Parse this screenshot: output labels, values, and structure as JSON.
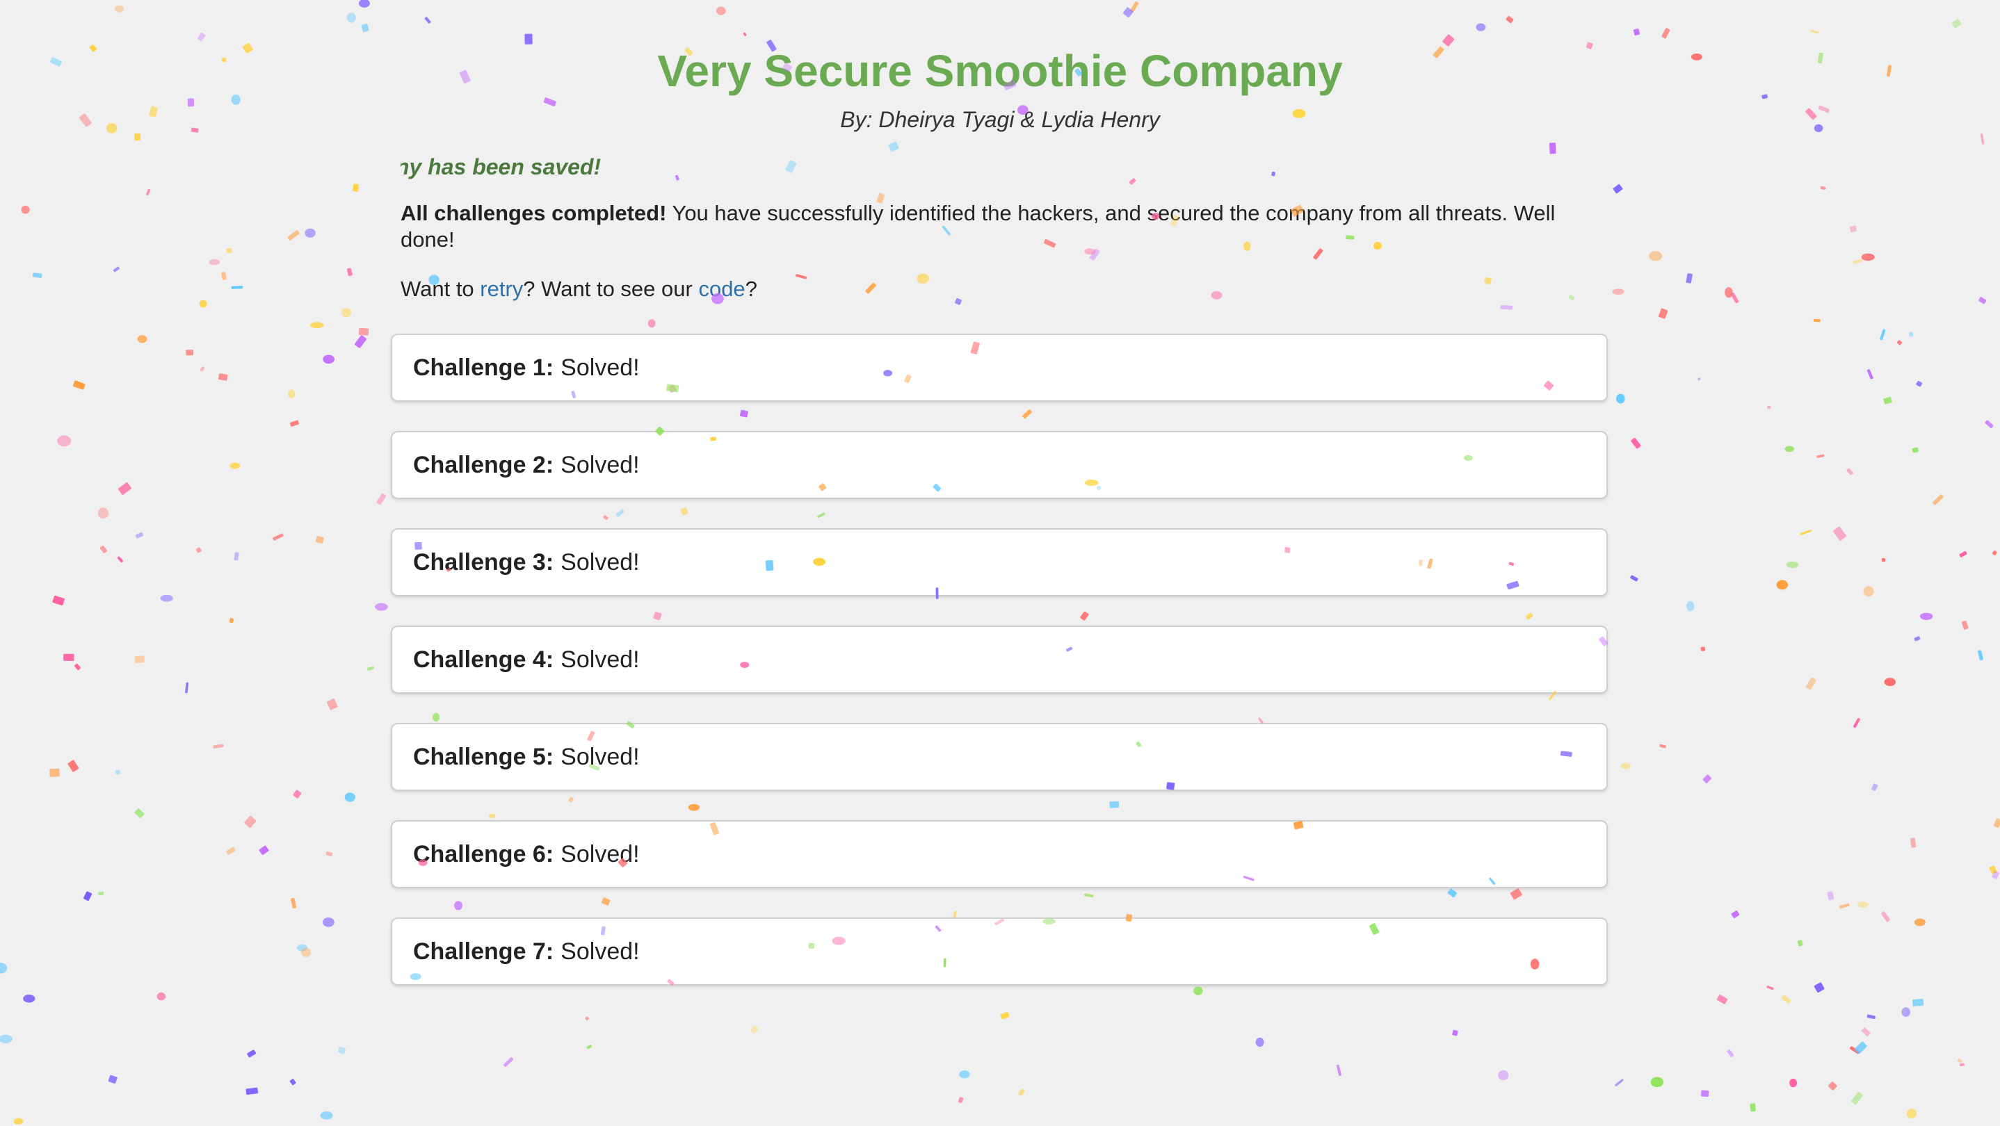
{
  "header": {
    "title": "Very Secure Smoothie Company",
    "byline": "By: Dheirya Tyagi & Lydia Henry"
  },
  "banner": {
    "scrolling_text": "The company has been saved!"
  },
  "message": {
    "bold": "All challenges completed!",
    "rest": " You have successfully identified the hackers, and secured the company from all threats. Well done!"
  },
  "links_line": {
    "prefix": "Want to ",
    "retry_label": "retry",
    "middle": "? Want to see our ",
    "code_label": "code",
    "suffix": "?"
  },
  "challenges": [
    {
      "name": "Challenge 1:",
      "status": "Solved!"
    },
    {
      "name": "Challenge 2:",
      "status": "Solved!"
    },
    {
      "name": "Challenge 3:",
      "status": "Solved!"
    },
    {
      "name": "Challenge 4:",
      "status": "Solved!"
    },
    {
      "name": "Challenge 5:",
      "status": "Solved!"
    },
    {
      "name": "Challenge 6:",
      "status": "Solved!"
    },
    {
      "name": "Challenge 7:",
      "status": "Solved!"
    }
  ],
  "colors": {
    "title": "#6aaa52",
    "banner": "#4b7a3e",
    "link": "#2f6fa8",
    "background": "#f0f0f0",
    "confetti": [
      "#ff5fa2",
      "#7b5cff",
      "#ffd23f",
      "#5ec8ff",
      "#8ee35b",
      "#ff9f40",
      "#c56cff",
      "#ff6b6b"
    ]
  }
}
